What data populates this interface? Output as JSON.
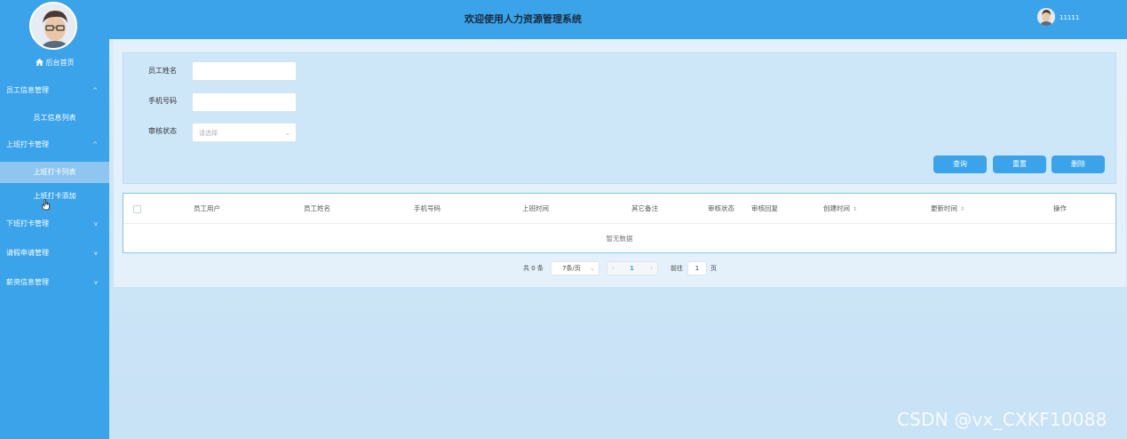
{
  "sidebar": {
    "home_label": "后台首页",
    "groups": [
      {
        "label": "员工信息管理",
        "chevron": "^",
        "subs": [
          "员工信息列表"
        ]
      },
      {
        "label": "上班打卡管理",
        "chevron": "^",
        "subs": [
          "上班打卡列表",
          "上班打卡添加"
        ]
      },
      {
        "label": "下班打卡管理",
        "chevron": "v",
        "subs": []
      },
      {
        "label": "请假申请管理",
        "chevron": "v",
        "subs": []
      },
      {
        "label": "薪资信息管理",
        "chevron": "v",
        "subs": []
      }
    ]
  },
  "header": {
    "title": "欢迎使用人力资源管理系统",
    "username": "11111"
  },
  "filters": {
    "name_label": "员工姓名",
    "phone_label": "手机号码",
    "status_label": "审核状态",
    "status_placeholder": "请选择"
  },
  "buttons": {
    "search": "查询",
    "reset": "重置",
    "delete": "删除"
  },
  "table": {
    "headers": [
      "员工用户",
      "员工姓名",
      "手机号码",
      "上班时间",
      "其它备注",
      "审核状态",
      "审核回复",
      "创建时间",
      "更新时间",
      "操作"
    ],
    "empty_text": "暂无数据"
  },
  "pager": {
    "total": "共 0 条",
    "page_size": "7条/页",
    "current_page": "1",
    "goto_prefix": "前往",
    "goto_value": "1",
    "goto_suffix": "页"
  },
  "watermark": "CSDN @vx_CXKF10088",
  "colors": {
    "primary": "#3aa3ea",
    "sidebar_active": "#8ec6f0"
  }
}
